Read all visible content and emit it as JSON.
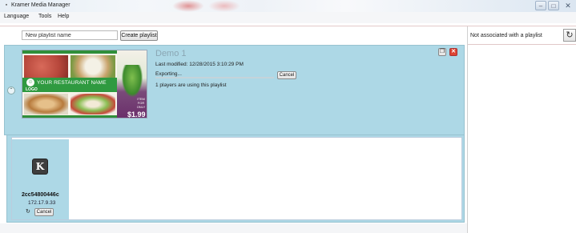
{
  "window": {
    "title": "Kramer Media Manager",
    "icon": "app-icon",
    "min_glyph": "–",
    "max_glyph": "□",
    "close_glyph": "✕"
  },
  "menu": {
    "items": [
      "Language",
      "Tools",
      "Help"
    ]
  },
  "toolbar": {
    "new_playlist_value": "New playlist name",
    "create_label": "Create playlist"
  },
  "playlist": {
    "name": "Demo 1",
    "last_modified": "Last modified: 12/28/2015 3:10:29 PM",
    "status": "Exporting...",
    "progress": 0.0,
    "cancel_label": "Cancel",
    "players_text": "1 players are using this playlist",
    "thumbnail": {
      "restaurant_name": "YOUR RESTAURANT NAME",
      "logo": "LOGO",
      "promo": "ITEM FOR ONLY",
      "price": "$1.99"
    },
    "icons": {
      "collapse": "collapse-chevron-icon",
      "copy": "copy-icon",
      "delete": "delete-icon"
    }
  },
  "player": {
    "name": "2cc54800446c",
    "ip": "172.17.9.33",
    "cancel_label": "Cancel",
    "logo_glyph": "K"
  },
  "right_panel": {
    "unassociated_label": "Not associated with a playlist",
    "refresh_glyph": "C"
  }
}
